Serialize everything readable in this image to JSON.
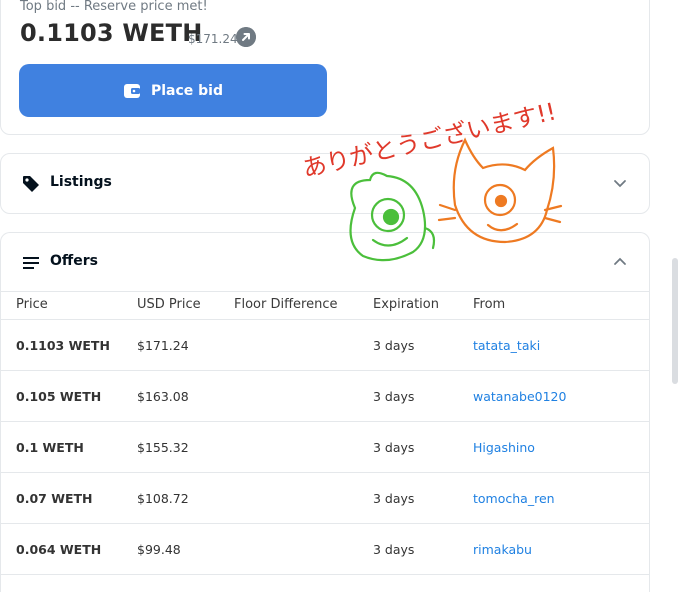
{
  "bid": {
    "top_label": "Top bid -- Reserve price met!",
    "price": "0.1103 WETH",
    "usd": "$171.24",
    "place_bid_label": "Place bid"
  },
  "listings": {
    "title": "Listings"
  },
  "offers": {
    "title": "Offers",
    "columns": [
      "Price",
      "USD Price",
      "Floor Difference",
      "Expiration",
      "From"
    ],
    "rows": [
      {
        "price": "0.1103 WETH",
        "usd": "$171.24",
        "floor": "",
        "expiration": "3 days",
        "from": "tatata_taki"
      },
      {
        "price": "0.105 WETH",
        "usd": "$163.08",
        "floor": "",
        "expiration": "3 days",
        "from": "watanabe0120"
      },
      {
        "price": "0.1 WETH",
        "usd": "$155.32",
        "floor": "",
        "expiration": "3 days",
        "from": "Higashino"
      },
      {
        "price": "0.07 WETH",
        "usd": "$108.72",
        "floor": "",
        "expiration": "3 days",
        "from": "tomocha_ren"
      },
      {
        "price": "0.064 WETH",
        "usd": "$99.48",
        "floor": "",
        "expiration": "3 days",
        "from": "rimakabu"
      }
    ]
  },
  "doodle": {
    "text": "ありがとうございます!!"
  },
  "colors": {
    "accent": "#4081e0",
    "link": "#2081e2",
    "doodle_red": "#e0392b",
    "doodle_green": "#4bbf3b",
    "doodle_orange": "#ee7a22"
  },
  "icons": [
    "arrow-up-right-icon",
    "wallet-icon",
    "tag-icon",
    "list-icon",
    "chevron-down-icon",
    "chevron-up-icon"
  ]
}
